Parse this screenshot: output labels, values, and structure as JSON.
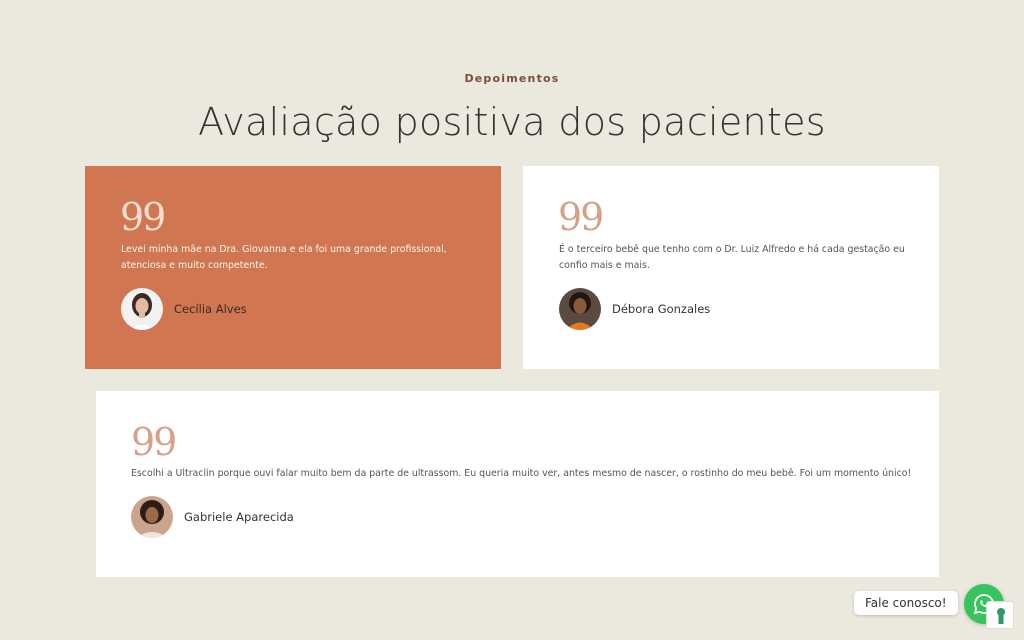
{
  "section": {
    "eyebrow": "Depoimentos",
    "title": "Avaliação positiva dos pacientes"
  },
  "testimonials": [
    {
      "quote_mark": "99",
      "text": "Levei minha mãe na Dra. Giovanna e ela foi uma grande profissional, atenciosa e muito competente.",
      "author": "Cecília Alves"
    },
    {
      "quote_mark": "99",
      "text": "É o terceiro bebê que tenho com o Dr. Luiz Alfredo e há cada gestação eu confio mais e mais.",
      "author": "Débora Gonzales"
    },
    {
      "quote_mark": "99",
      "text": "Escolhi a Ultraclin porque ouvi falar muito bem da parte de ultrassom. Eu queria muito ver, antes mesmo de nascer, o rostinho do meu bebê. Foi um momento único!",
      "author": "Gabriele Aparecida"
    }
  ],
  "chat_widget": {
    "label": "Fale conosco!",
    "icon": "whatsapp-icon"
  },
  "colors": {
    "background": "#ebe8de",
    "accent_card": "#d07650",
    "whatsapp_green": "#36c45e"
  }
}
